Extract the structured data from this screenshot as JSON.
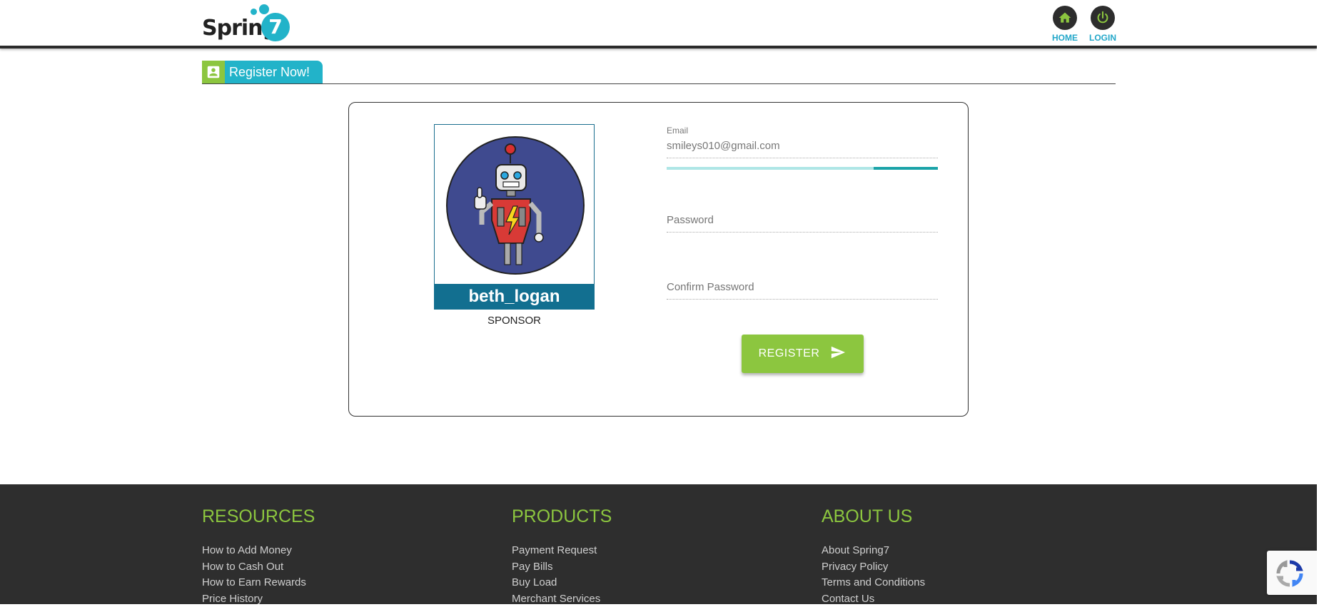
{
  "header": {
    "logo_text": "Spring",
    "logo_number": "7",
    "nav": [
      {
        "label": "HOME",
        "icon": "home-icon"
      },
      {
        "label": "LOGIN",
        "icon": "power-icon"
      }
    ]
  },
  "section": {
    "title": "Register Now!",
    "icon": "account-box-icon"
  },
  "sponsor": {
    "username": "beth_logan",
    "role": "SPONSOR",
    "avatar": "robot-avatar"
  },
  "form": {
    "email_label": "Email",
    "email_value": "smileys010@gmail.com",
    "password_placeholder": "Password",
    "confirm_placeholder": "Confirm Password",
    "register_label": "REGISTER"
  },
  "footer": {
    "resources": {
      "title": "RESOURCES",
      "links": [
        "How to Add Money",
        "How to Cash Out",
        "How to Earn Rewards",
        "Price History"
      ]
    },
    "products": {
      "title": "PRODUCTS",
      "links": [
        "Payment Request",
        "Pay Bills",
        "Buy Load",
        "Merchant Services"
      ]
    },
    "about": {
      "title": "ABOUT US",
      "links": [
        "About Spring7",
        "Privacy Policy",
        "Terms and Conditions",
        "Contact Us"
      ]
    }
  },
  "colors": {
    "brand_teal": "#22b3c9",
    "brand_green": "#8cc63f",
    "name_bar": "#126f90",
    "footer_bg": "#2e2e2e"
  }
}
